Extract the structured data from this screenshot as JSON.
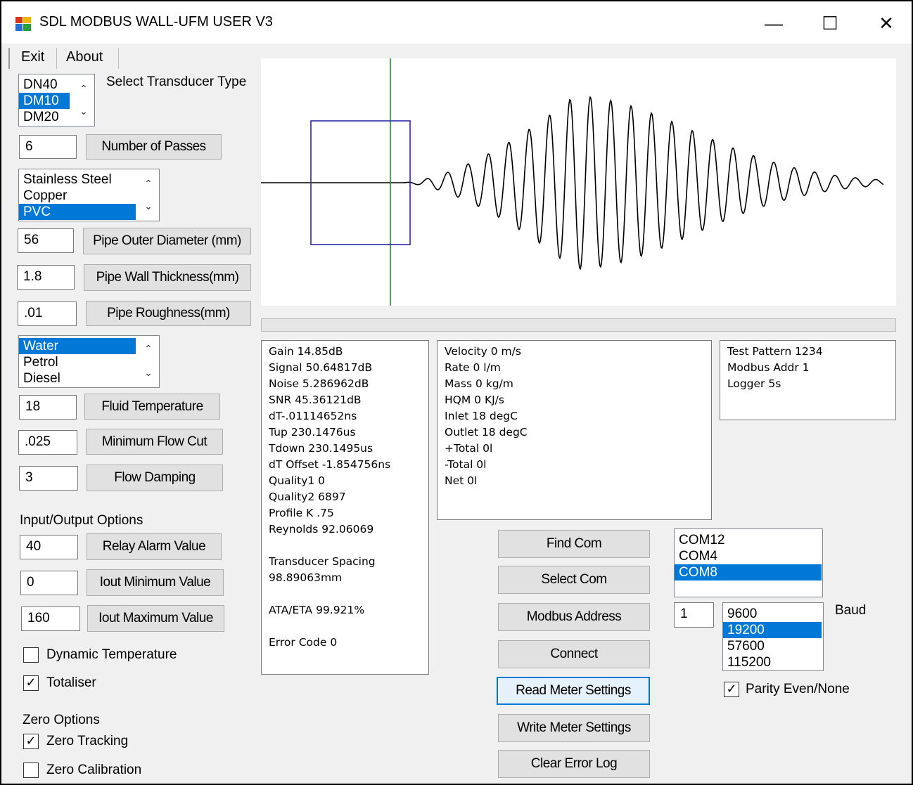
{
  "window": {
    "title": "SDL MODBUS WALL-UFM USER V3",
    "minimize_glyph": "—",
    "maximize_glyph": "☐",
    "close_glyph": "✕"
  },
  "menu": {
    "items": [
      "Exit",
      "About"
    ]
  },
  "transducer": {
    "options": [
      "DN40",
      "DM10",
      "DM20"
    ],
    "selected": "DM10",
    "label": "Select Transducer Type"
  },
  "passes": {
    "value": "6",
    "label": "Number of Passes"
  },
  "material": {
    "options": [
      "Stainless Steel",
      "Copper",
      "PVC"
    ],
    "selected": "PVC"
  },
  "outer_diameter": {
    "value": "56",
    "label": "Pipe Outer Diameter (mm)"
  },
  "wall_thickness": {
    "value": "1.8",
    "label": "Pipe Wall Thickness(mm)"
  },
  "roughness": {
    "value": ".01",
    "label": "Pipe Roughness(mm)"
  },
  "fluid": {
    "options": [
      "Water",
      "Petrol",
      "Diesel"
    ],
    "selected": "Water"
  },
  "fluid_temp": {
    "value": "18",
    "label": "Fluid Temperature"
  },
  "min_flow_cut": {
    "value": ".025",
    "label": "Minimum Flow Cut"
  },
  "flow_damping": {
    "value": "3",
    "label": "Flow Damping"
  },
  "io": {
    "heading": "Input/Output Options",
    "relay_alarm": {
      "value": "40",
      "label": "Relay Alarm Value"
    },
    "iout_min": {
      "value": "0",
      "label": "Iout Minimum Value"
    },
    "iout_max": {
      "value": "160",
      "label": "Iout Maximum Value"
    },
    "dynamic_temperature": {
      "label": "Dynamic Temperature",
      "checked": false
    },
    "totaliser": {
      "label": "Totaliser",
      "checked": true
    }
  },
  "zero": {
    "heading": "Zero Options",
    "tracking": {
      "label": "Zero Tracking",
      "checked": true
    },
    "calibration": {
      "label": "Zero Calibration",
      "checked": false
    }
  },
  "check_glyph": "✓",
  "signal_panel": [
    "Gain 14.85dB",
    "Signal 50.64817dB",
    "Noise 5.286962dB",
    "SNR 45.36121dB",
    "dT-.01114652ns",
    "Tup 230.1476us",
    "Tdown 230.1495us",
    "dT Offset -1.854756ns",
    "Quality1 0",
    "Quality2 6897",
    "Profile K .75",
    "Reynolds 92.06069",
    "",
    "Transducer Spacing",
    "98.89063mm",
    "",
    "ATA/ETA 99.921%",
    "",
    "Error Code 0"
  ],
  "flow_panel": [
    "Velocity 0 m/s",
    "Rate 0 l/m",
    "Mass 0 kg/m",
    "HQM 0 KJ/s",
    "Inlet 18 degC",
    "Outlet 18 degC",
    "+Total 0l",
    "-Total 0l",
    "Net 0l"
  ],
  "info_panel": [
    "Test Pattern 1234",
    "Modbus Addr 1",
    "Logger 5s"
  ],
  "buttons": {
    "find_com": "Find Com",
    "select_com": "Select Com",
    "modbus_address": "Modbus Address",
    "connect": "Connect",
    "read_settings": "Read Meter Settings",
    "write_settings": "Write Meter Settings",
    "clear_error": "Clear Error Log"
  },
  "com": {
    "options": [
      "COM12",
      "COM4",
      "COM8"
    ],
    "selected": "COM8"
  },
  "modbus_addr_value": "1",
  "baud": {
    "label": "Baud",
    "options": [
      "9600",
      "19200",
      "57600",
      "115200"
    ],
    "selected": "19200"
  },
  "parity": {
    "label": "Parity Even/None",
    "checked": true
  },
  "scrollbar": {
    "up_glyph": "⌃",
    "down_glyph": "⌄"
  },
  "colors": {
    "selection": "#0078d7",
    "waveform": "#000000",
    "marker_line": "#2e8b2e",
    "marker_box": "#2a2aa8"
  }
}
